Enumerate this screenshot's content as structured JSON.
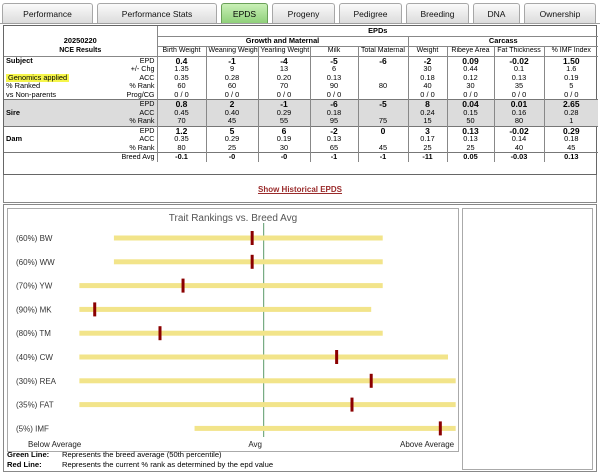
{
  "tabs": [
    {
      "label": "Performance",
      "active": false
    },
    {
      "label": "Performance Stats",
      "active": false
    },
    {
      "label": "EPDS",
      "active": true
    },
    {
      "label": "Progeny",
      "active": false
    },
    {
      "label": "Pedigree",
      "active": false
    },
    {
      "label": "Breeding",
      "active": false
    },
    {
      "label": "DNA",
      "active": false
    },
    {
      "label": "Ownership",
      "active": false
    }
  ],
  "epd": {
    "top_header": "EPDs",
    "group_growth": "Growth and Maternal",
    "group_carcass": "Carcass",
    "run_date": "20250220",
    "run_label": "NCE Results",
    "columns": [
      "Birth Weight",
      "Weaning Weight",
      "Yearling Weight",
      "Milk",
      "Total Maternal",
      "Weight",
      "Ribeye Area",
      "Fat Thickness",
      "% IMF Index"
    ],
    "subject": {
      "label": "Subject",
      "genomics": "Genomics applied",
      "pct_ranked": "% Ranked",
      "vs_nonparents": "vs Non-parents",
      "row_labels": [
        "EPD",
        "+/- Chg",
        "ACC",
        "% Rank",
        "Prog/CG"
      ],
      "rows": [
        [
          "0.4",
          "-1",
          "-4",
          "-5",
          "-6",
          "-2",
          "0.09",
          "-0.02",
          "1.50"
        ],
        [
          "1.35",
          "9",
          "13",
          "6",
          "",
          "30",
          "0.44",
          "0.1",
          "1.6"
        ],
        [
          "0.35",
          "0.28",
          "0.20",
          "0.13",
          "",
          "0.18",
          "0.12",
          "0.13",
          "0.19"
        ],
        [
          "60",
          "60",
          "70",
          "90",
          "80",
          "40",
          "30",
          "35",
          "5"
        ],
        [
          "0 / 0",
          "0 / 0",
          "0 / 0",
          "0 / 0",
          "",
          "0 / 0",
          "0 / 0",
          "0 / 0",
          "0 / 0"
        ]
      ]
    },
    "sire": {
      "label": "Sire",
      "row_labels": [
        "EPD",
        "ACC",
        "% Rank"
      ],
      "rows": [
        [
          "0.8",
          "2",
          "-1",
          "-6",
          "-5",
          "8",
          "0.04",
          "0.01",
          "2.65"
        ],
        [
          "0.45",
          "0.40",
          "0.29",
          "0.18",
          "",
          "0.24",
          "0.15",
          "0.16",
          "0.28"
        ],
        [
          "70",
          "45",
          "55",
          "95",
          "75",
          "15",
          "50",
          "80",
          "1"
        ]
      ]
    },
    "dam": {
      "label": "Dam",
      "row_labels": [
        "EPD",
        "ACC",
        "% Rank"
      ],
      "rows": [
        [
          "1.2",
          "5",
          "6",
          "-2",
          "0",
          "3",
          "0.13",
          "-0.02",
          "0.29"
        ],
        [
          "0.35",
          "0.29",
          "0.19",
          "0.13",
          "",
          "0.17",
          "0.13",
          "0.14",
          "0.18"
        ],
        [
          "80",
          "25",
          "30",
          "65",
          "45",
          "25",
          "25",
          "40",
          "45"
        ]
      ]
    },
    "breed_avg": {
      "label": "Breed Avg",
      "values": [
        "-0.1",
        "-0",
        "-0",
        "-1",
        "-1",
        "-11",
        "0.05",
        "-0.03",
        "0.13"
      ]
    }
  },
  "history_link": "Show Historical EPDS",
  "chart_data": {
    "type": "bar",
    "title": "Trait Rankings vs. Breed Avg",
    "x_left_label": "Below Average",
    "x_mid_label": "Avg",
    "x_right_label": "Above Average",
    "grid": false,
    "colors": {
      "range": "#f2e48a",
      "marker": "#8b0000",
      "avg_line": "#5a9a6a"
    },
    "traits": [
      {
        "label": "(60%) BW",
        "range": [
          0.13,
          0.83
        ],
        "marker": 0.49
      },
      {
        "label": "(60%) WW",
        "range": [
          0.13,
          0.83
        ],
        "marker": 0.49
      },
      {
        "label": "(70%) YW",
        "range": [
          0.04,
          0.83
        ],
        "marker": 0.31
      },
      {
        "label": "(90%) MK",
        "range": [
          0.04,
          0.8
        ],
        "marker": 0.08
      },
      {
        "label": "(80%) TM",
        "range": [
          0.04,
          0.83
        ],
        "marker": 0.25
      },
      {
        "label": "(40%) CW",
        "range": [
          0.04,
          1.0
        ],
        "marker": 0.71
      },
      {
        "label": "(30%) REA",
        "range": [
          0.04,
          1.02
        ],
        "marker": 0.8
      },
      {
        "label": "(35%) FAT",
        "range": [
          0.04,
          1.02
        ],
        "marker": 0.75
      },
      {
        "label": "(5%) IMF",
        "range": [
          0.34,
          1.02
        ],
        "marker": 0.98
      }
    ]
  },
  "legend": [
    {
      "key": "Green Line:",
      "text": "Represents the breed average (50th percentile)"
    },
    {
      "key": "Red Line:",
      "text": "Represents the current % rank as determined by the epd value"
    }
  ]
}
